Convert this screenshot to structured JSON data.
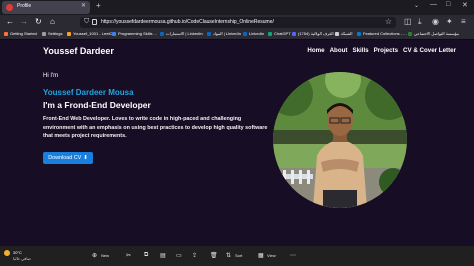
{
  "browser": {
    "tab_title": "Profile",
    "url": "https://youssefdardeermousa.github.io/CodeClauseInternship_OnlineResume/",
    "bookmarks": [
      "Getting Started",
      "Settings",
      "Youssef_1001 - LeetC...",
      "Programming Skills ...",
      "الاستمارات | LinkedIn",
      "المواد | LinkedIn",
      "LinkedIn",
      "ChatGPT",
      "(1754) الغرف الولائية - ...",
      "الشبكة",
      "Featured Collections - ...",
      "مؤسسة التواصل الاجتماعي"
    ]
  },
  "site": {
    "brand": "Youssef Dardeer",
    "nav": [
      "Home",
      "About",
      "Skills",
      "Projects",
      "CV & Cover Letter"
    ],
    "greeting": "Hi I'm",
    "name": "Youssef Dardeer Mousa",
    "role": "I'm a Frond-End Developer",
    "description": "Front-End Web Developer. Loves to write code in high-paced and challenging environment with an emphasis on using best practices to develop high quality software that meets project requirements.",
    "cv_button": "Download CV",
    "accent_color": "#1ea7e1",
    "button_color": "#1a7fdc"
  },
  "taskbar": {
    "weather_temp": "30°C",
    "weather_desc": "صافي غالبا",
    "new_label": "New",
    "sort_label": "Sort",
    "view_label": "View"
  }
}
